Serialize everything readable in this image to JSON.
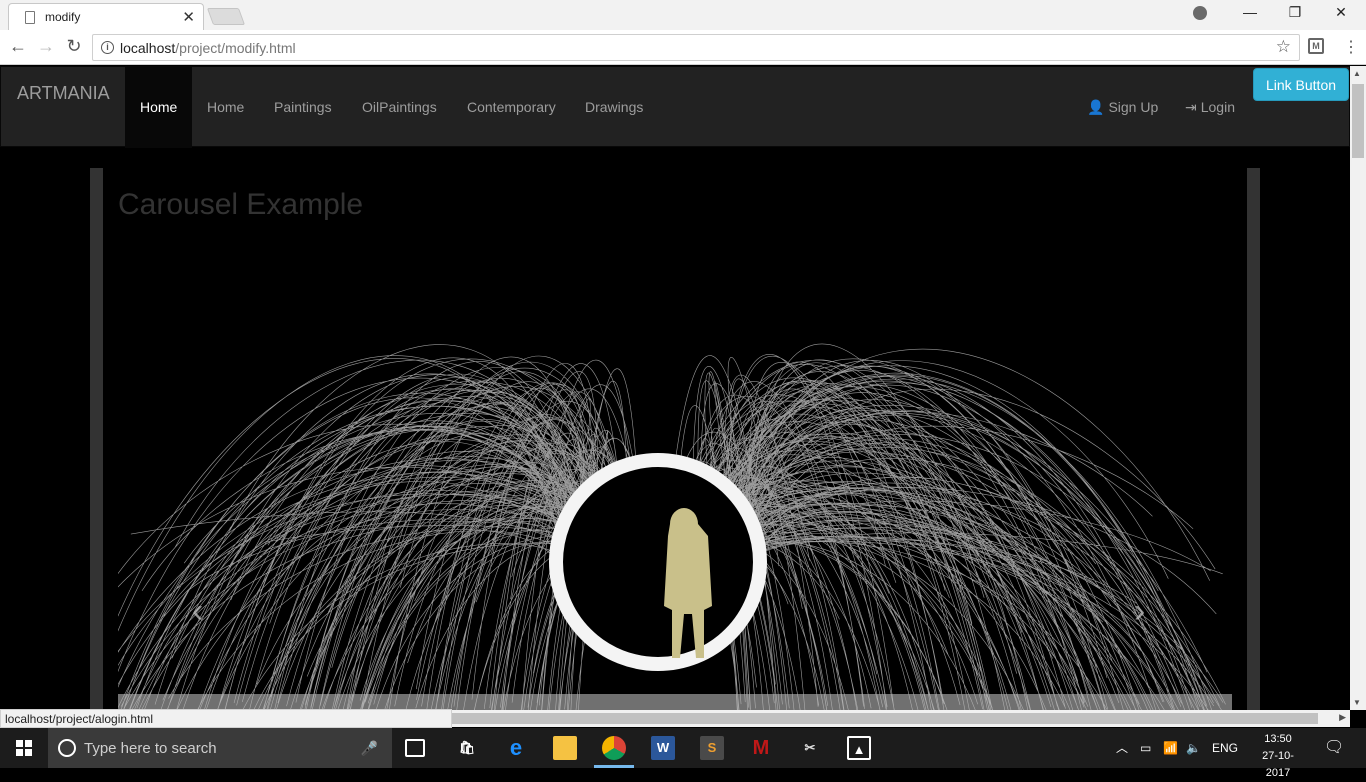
{
  "browser": {
    "tab_title": "modify",
    "tab_close": "✕",
    "url_host": "localhost",
    "url_path": "/project/modify.html",
    "status_url": "localhost/project/alogin.html"
  },
  "navbar": {
    "brand": "ARTMANIA",
    "items": [
      {
        "label": "Home",
        "active": true
      },
      {
        "label": "Home"
      },
      {
        "label": "Paintings"
      },
      {
        "label": "OilPaintings"
      },
      {
        "label": "Contemporary"
      },
      {
        "label": "Drawings"
      }
    ],
    "signup_label": "Sign Up",
    "login_label": "Login",
    "link_button_label": "Link Button",
    "accent_color": "#31b0d5"
  },
  "main": {
    "carousel_title": "Carousel Example",
    "prev_glyph": "‹",
    "next_glyph": "›"
  },
  "taskbar": {
    "search_placeholder": "Type here to search",
    "language": "ENG",
    "time": "13:50",
    "date": "27-10-2017"
  }
}
